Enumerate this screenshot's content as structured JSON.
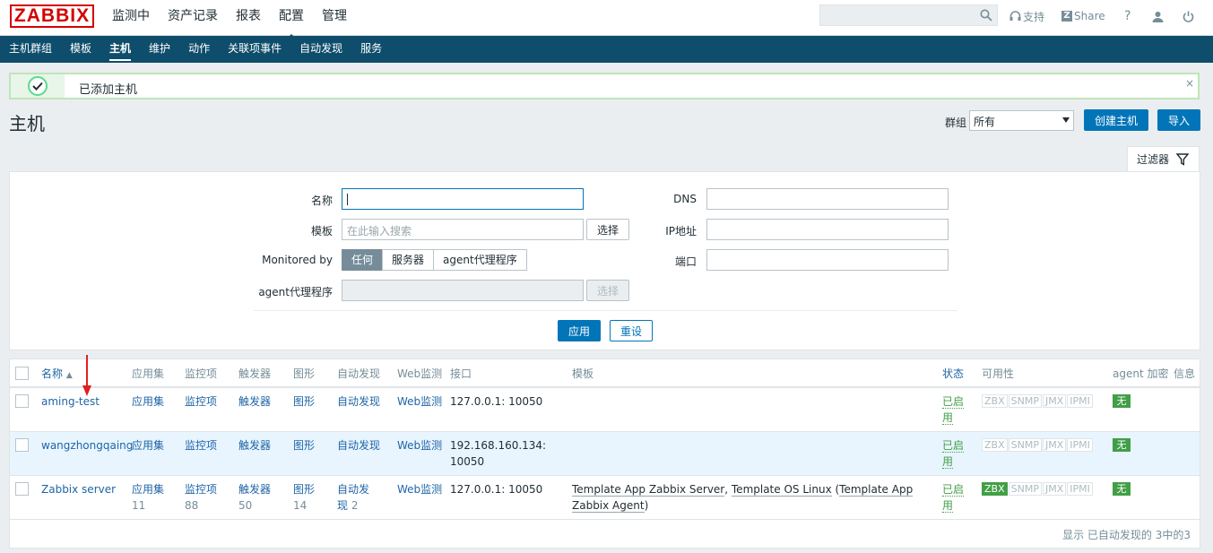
{
  "header": {
    "logo": "ZABBIX",
    "main_nav": [
      "监测中",
      "资产记录",
      "报表",
      "配置",
      "管理"
    ],
    "active_main": "配置",
    "search_placeholder": "",
    "support": "支持",
    "share": "Share",
    "help": "?"
  },
  "subnav": [
    "主机群组",
    "模板",
    "主机",
    "维护",
    "动作",
    "关联项事件",
    "自动发现",
    "服务"
  ],
  "active_subnav": "主机",
  "message": {
    "text": "已添加主机",
    "close": "×"
  },
  "page": {
    "title": "主机",
    "group_label": "群组",
    "group_value": "所有",
    "create_button": "创建主机",
    "import_button": "导入"
  },
  "filter": {
    "tab_label": "过滤器",
    "name_label": "名称",
    "name_value": "",
    "template_label": "模板",
    "template_placeholder": "在此输入搜索",
    "select_label": "选择",
    "monitored_label": "Monitored by",
    "monitored_options": [
      "任何",
      "服务器",
      "agent代理程序"
    ],
    "monitored_selected": "任何",
    "proxy_label": "agent代理程序",
    "proxy_select": "选择",
    "dns_label": "DNS",
    "ip_label": "IP地址",
    "port_label": "端口",
    "apply": "应用",
    "reset": "重设"
  },
  "table": {
    "headers": [
      "名称",
      "应用集",
      "监控项",
      "触发器",
      "图形",
      "自动发现",
      "Web监测",
      "接口",
      "模板",
      "状态",
      "可用性",
      "agent 加密",
      "信息"
    ],
    "sort_indicator": "▲",
    "rows": [
      {
        "name": "aming-test",
        "apps": "应用集",
        "apps_count": "",
        "items": "监控项",
        "items_count": "",
        "triggers": "触发器",
        "triggers_count": "",
        "graphs": "图形",
        "graphs_count": "",
        "discovery": "自动发现",
        "discovery_count": "",
        "web": "Web监测",
        "interface": "127.0.0.1: 10050",
        "templates": "",
        "status": "已启用",
        "availability": [
          "ZBX",
          "SNMP",
          "JMX",
          "IPMI"
        ],
        "zbx_on": false,
        "encryption": "无"
      },
      {
        "name": "wangzhongqaing",
        "apps": "应用集",
        "apps_count": "",
        "items": "监控项",
        "items_count": "",
        "triggers": "触发器",
        "triggers_count": "",
        "graphs": "图形",
        "graphs_count": "",
        "discovery": "自动发现",
        "discovery_count": "",
        "web": "Web监测",
        "interface": "192.168.160.134: 10050",
        "templates": "",
        "status": "已启用",
        "availability": [
          "ZBX",
          "SNMP",
          "JMX",
          "IPMI"
        ],
        "zbx_on": false,
        "encryption": "无"
      },
      {
        "name": "Zabbix server",
        "apps": "应用集",
        "apps_count": "11",
        "items": "监控项",
        "items_count": "88",
        "triggers": "触发器",
        "triggers_count": "50",
        "graphs": "图形",
        "graphs_count": "14",
        "discovery": "自动发现",
        "discovery_count": "2",
        "web": "Web监测",
        "interface": "127.0.0.1: 10050",
        "template_1": "Template App Zabbix Server",
        "template_2": "Template OS Linux",
        "template_3": "Template App Zabbix Agent",
        "status": "已启用",
        "availability": [
          "ZBX",
          "SNMP",
          "JMX",
          "IPMI"
        ],
        "zbx_on": true,
        "encryption": "无"
      }
    ],
    "footer": "显示 已自动发现的 3中的3"
  },
  "colors": {
    "brand": "#d40000",
    "nav": "#0e4d6b",
    "primary": "#0275b8",
    "link": "#1f65a6",
    "ok": "#429e47"
  }
}
